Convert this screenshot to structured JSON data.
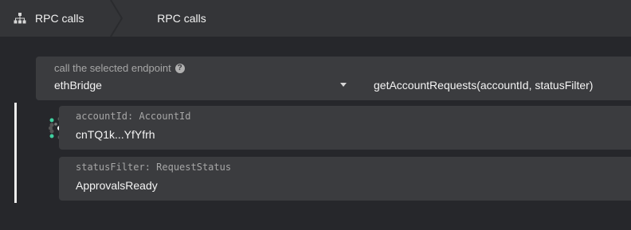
{
  "nav": {
    "section_label": "RPC calls",
    "active_tab_label": "RPC calls"
  },
  "endpoint": {
    "label": "call the selected endpoint",
    "section": "ethBridge",
    "method": "getAccountRequests(accountId, statusFilter)"
  },
  "params": [
    {
      "label": "accountId: AccountId",
      "value": "cnTQ1k...YfYfrh"
    },
    {
      "label": "statusFilter: RequestStatus",
      "value": "ApprovalsReady"
    }
  ],
  "icons": {
    "network": "network-icon",
    "help": "help-icon",
    "caret": "chevron-down-icon",
    "identicon": "identicon-avatar"
  },
  "colors": {
    "background": "#26272b",
    "topbar": "#343538",
    "panel": "#3b3c3f",
    "identicon_accent": "#3fcf9f"
  }
}
